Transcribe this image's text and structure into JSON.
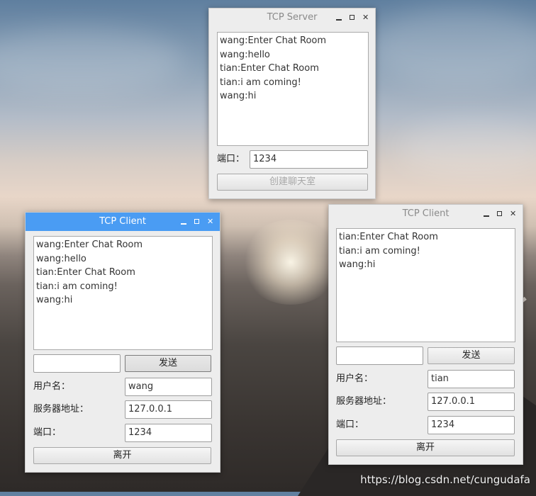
{
  "server": {
    "title": "TCP Server",
    "messages": [
      "wang:Enter Chat Room",
      "wang:hello",
      "tian:Enter Chat Room",
      "tian:i am coming!",
      "wang:hi"
    ],
    "port_label": "端口：",
    "port_value": "1234",
    "create_button": "创建聊天室"
  },
  "client_left": {
    "title": "TCP Client",
    "messages": [
      "wang:Enter Chat Room",
      "wang:hello",
      "tian:Enter Chat Room",
      "tian:i am coming!",
      "wang:hi"
    ],
    "message_input": "",
    "send_button": "发送",
    "username_label": "用户名：",
    "username_value": "wang",
    "server_label": "服务器地址：",
    "server_value": "127.0.0.1",
    "port_label": "端口：",
    "port_value": "1234",
    "leave_button": "离开"
  },
  "client_right": {
    "title": "TCP Client",
    "messages": [
      "tian:Enter Chat Room",
      "tian:i am coming!",
      "wang:hi"
    ],
    "message_input": "",
    "send_button": "发送",
    "username_label": "用户名：",
    "username_value": "tian",
    "server_label": "服务器地址：",
    "server_value": "127.0.0.1",
    "port_label": "端口：",
    "port_value": "1234",
    "leave_button": "离开"
  },
  "watermark": "https://blog.csdn.net/cungudafa",
  "colors": {
    "active_titlebar": "#4a9cf3",
    "window_bg": "#ededed"
  }
}
